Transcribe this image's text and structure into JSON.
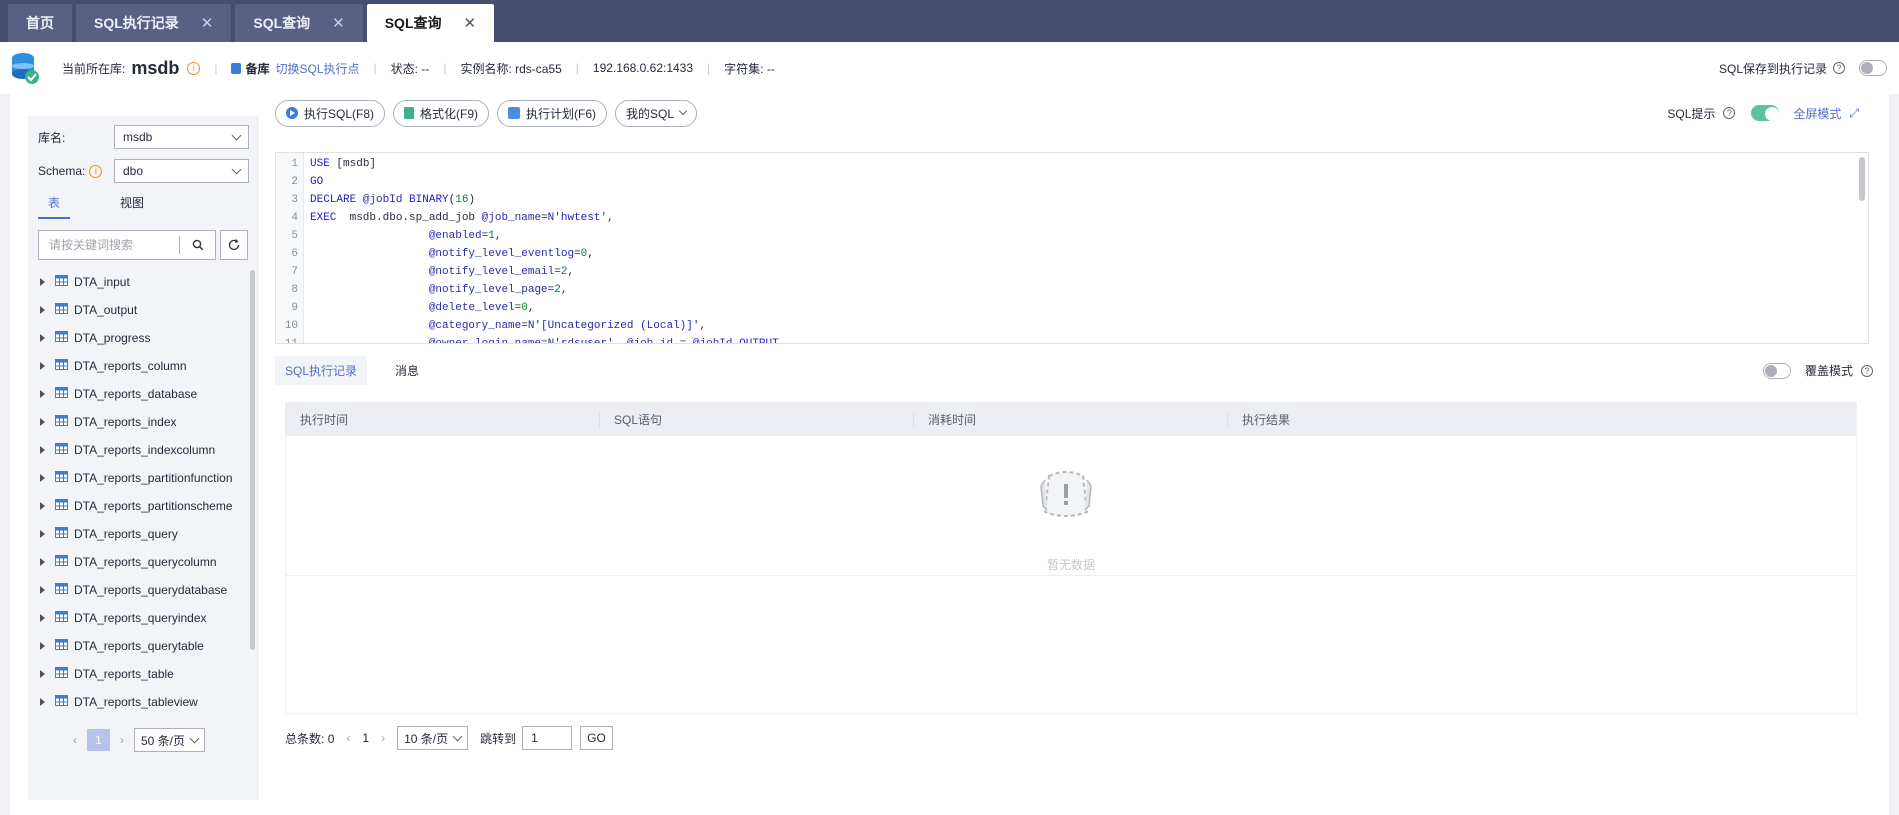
{
  "tabs": [
    {
      "label": "首页",
      "closable": false,
      "active": false
    },
    {
      "label": "SQL执行记录",
      "closable": true,
      "active": false
    },
    {
      "label": "SQL查询",
      "closable": true,
      "active": false
    },
    {
      "label": "SQL查询",
      "closable": true,
      "active": true
    }
  ],
  "infobar": {
    "current_db_label": "当前所在库:",
    "current_db": "msdb",
    "backup_label": "备库",
    "switch_link": "切换SQL执行点",
    "status": "状态: --",
    "instance": "实例名称: rds-ca55",
    "address": "192.168.0.62:1433",
    "charset": "字符集: --",
    "save_label": "SQL保存到执行记录"
  },
  "left": {
    "db_label": "库名:",
    "db_value": "msdb",
    "schema_label": "Schema:",
    "schema_value": "dbo",
    "tabs": [
      "表",
      "视图"
    ],
    "search_placeholder": "请按关键词搜索",
    "tables": [
      "DTA_input",
      "DTA_output",
      "DTA_progress",
      "DTA_reports_column",
      "DTA_reports_database",
      "DTA_reports_index",
      "DTA_reports_indexcolumn",
      "DTA_reports_partitionfunction",
      "DTA_reports_partitionscheme",
      "DTA_reports_query",
      "DTA_reports_querycolumn",
      "DTA_reports_querydatabase",
      "DTA_reports_queryindex",
      "DTA_reports_querytable",
      "DTA_reports_table",
      "DTA_reports_tableview"
    ],
    "pager": {
      "page": "1",
      "size": "50 条/页"
    }
  },
  "toolbar": {
    "execute": "执行SQL(F8)",
    "format": "格式化(F9)",
    "plan": "执行计划(F6)",
    "my_sql": "我的SQL",
    "sql_hint": "SQL提示",
    "fullscreen": "全屏模式"
  },
  "editor": {
    "lines": [
      "USE [msdb]",
      "GO",
      "DECLARE @jobId BINARY(16)",
      "EXEC  msdb.dbo.sp_add_job @job_name=N'hwtest',",
      "                  @enabled=1,",
      "                  @notify_level_eventlog=0,",
      "                  @notify_level_email=2,",
      "                  @notify_level_page=2,",
      "                  @delete_level=0,",
      "                  @category_name=N'[Uncategorized (Local)]',",
      "                  @owner_login_name=N'rdsuser', @job_id = @jobId OUTPUT"
    ]
  },
  "results": {
    "tabs": [
      "SQL执行记录",
      "消息"
    ],
    "cover_mode": "覆盖模式",
    "columns": [
      "执行时间",
      "SQL语句",
      "消耗时间",
      "执行结果"
    ],
    "empty_text": "暂无数据",
    "pager": {
      "total_label": "总条数:",
      "total": "0",
      "page": "1",
      "size": "10 条/页",
      "jump_label": "跳转到",
      "jump_value": "1",
      "go": "GO"
    }
  },
  "colors": {
    "header_bg": "#474d6f",
    "accent": "#526ecc",
    "toggle_on": "#5ec29a"
  }
}
